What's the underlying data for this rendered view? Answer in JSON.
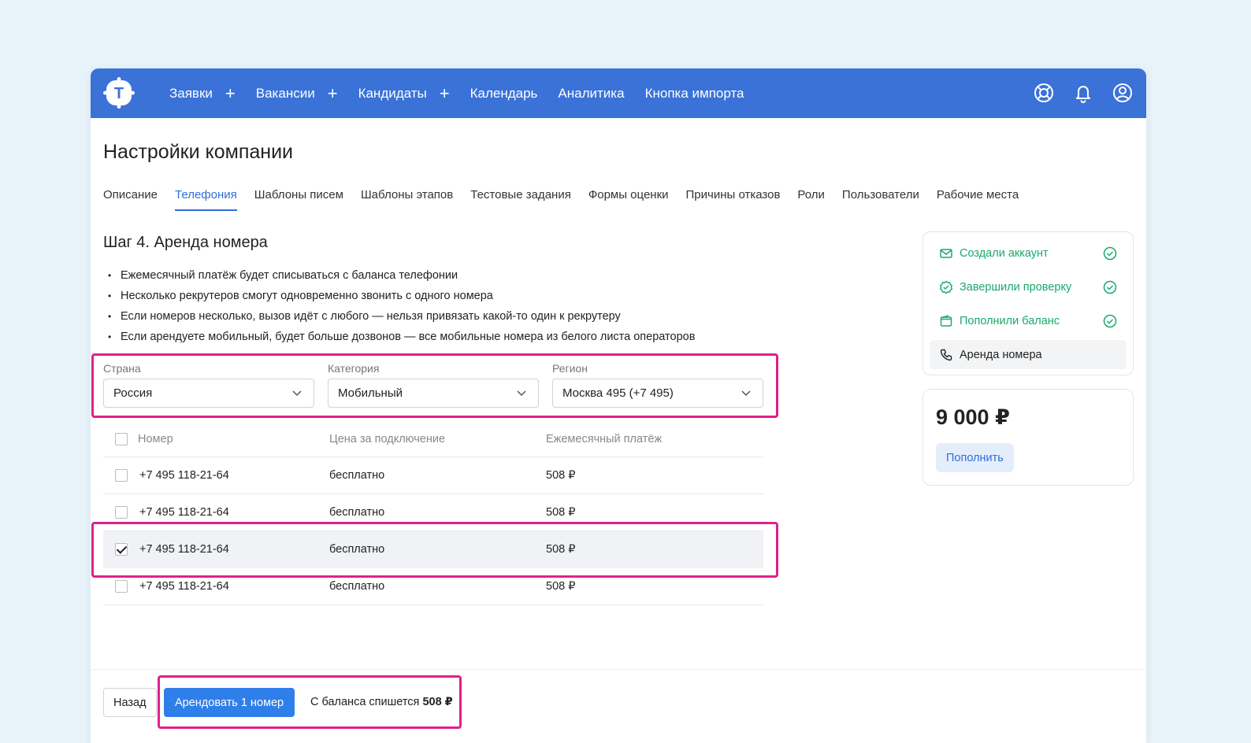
{
  "nav": {
    "logo_letter": "T",
    "items": [
      {
        "label": "Заявки",
        "plus": true
      },
      {
        "label": "Вакансии",
        "plus": true
      },
      {
        "label": "Кандидаты",
        "plus": true
      },
      {
        "label": "Календарь",
        "plus": false
      },
      {
        "label": "Аналитика",
        "plus": false
      },
      {
        "label": "Кнопка импорта",
        "plus": false
      }
    ],
    "plus_symbol": "+",
    "icons": [
      "lifebuoy-icon",
      "bell-icon",
      "user-icon"
    ]
  },
  "page": {
    "title": "Настройки компании",
    "tabs": [
      {
        "label": "Описание",
        "active": false
      },
      {
        "label": "Телефония",
        "active": true
      },
      {
        "label": "Шаблоны писем",
        "active": false
      },
      {
        "label": "Шаблоны этапов",
        "active": false
      },
      {
        "label": "Тестовые задания",
        "active": false
      },
      {
        "label": "Формы оценки",
        "active": false
      },
      {
        "label": "Причины отказов",
        "active": false
      },
      {
        "label": "Роли",
        "active": false
      },
      {
        "label": "Пользователи",
        "active": false
      },
      {
        "label": "Рабочие места",
        "active": false
      }
    ]
  },
  "step": {
    "title": "Шаг 4. Аренда номера",
    "bullets": [
      "Ежемесячный платёж будет списываться с баланса телефонии",
      "Несколько рекрутеров смогут одновременно звонить с одного номера",
      "Если номеров несколько, вызов идёт с любого — нельзя привязать какой-то один к рекрутеру",
      "Если арендуете мобильный, будет больше дозвонов — все мобильные номера из белого листа операторов"
    ]
  },
  "filters": {
    "country": {
      "label": "Страна",
      "value": "Россия"
    },
    "category": {
      "label": "Категория",
      "value": "Мобильный"
    },
    "region": {
      "label": "Регион",
      "value": "Москва 495 (+7 495)"
    }
  },
  "table": {
    "headers": {
      "number": "Номер",
      "price": "Цена за подключение",
      "monthly": "Ежемесячный платёж"
    },
    "rows": [
      {
        "number": "+7 495 118-21-64",
        "price": "бесплатно",
        "monthly": "508 ₽",
        "checked": false
      },
      {
        "number": "+7 495 118-21-64",
        "price": "бесплатно",
        "monthly": "508 ₽",
        "checked": false
      },
      {
        "number": "+7 495 118-21-64",
        "price": "бесплатно",
        "monthly": "508 ₽",
        "checked": true
      },
      {
        "number": "+7 495 118-21-64",
        "price": "бесплатно",
        "monthly": "508 ₽",
        "checked": false
      }
    ]
  },
  "progress": {
    "items": [
      {
        "label": "Создали аккаунт",
        "icon": "mail-icon",
        "done": true
      },
      {
        "label": "Завершили проверку",
        "icon": "verified-badge-icon",
        "done": true
      },
      {
        "label": "Пополнили баланс",
        "icon": "wallet-icon",
        "done": true
      },
      {
        "label": "Аренда номера",
        "icon": "phone-icon",
        "done": false
      }
    ]
  },
  "balance": {
    "amount": "9 000 ₽",
    "topup_label": "Пополнить"
  },
  "footer": {
    "back_label": "Назад",
    "rent_label": "Арендовать 1 номер",
    "charge_prefix": "С баланса спишется",
    "charge_amount": "508 ₽"
  },
  "colors": {
    "nav_bg": "#3a72d8",
    "accent": "#2f7fea",
    "success": "#1aa86b",
    "highlight": "#e0208a",
    "page_bg": "#e7f2f9"
  }
}
